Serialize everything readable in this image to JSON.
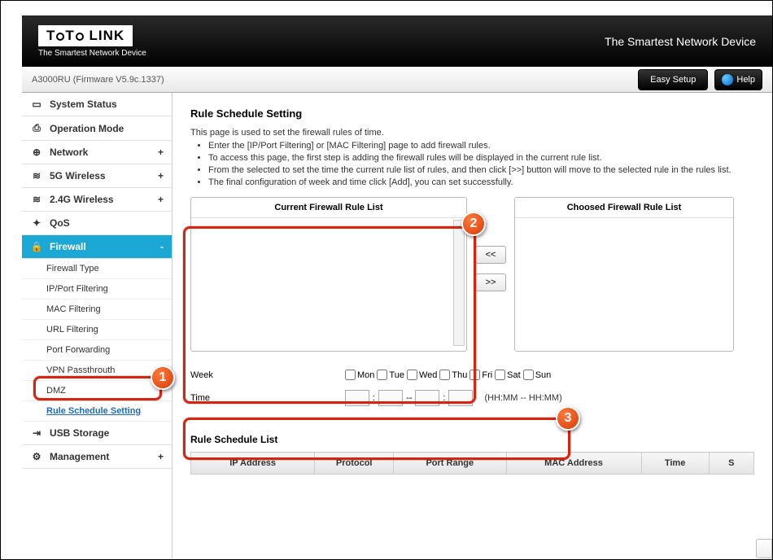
{
  "brand": {
    "name": "TOTO LINK",
    "tagline": "The Smartest Network Device"
  },
  "top_tagline": "The Smartest Network Device",
  "infobar": {
    "model": "A3000RU (Firmware V5.9c.1337)",
    "easy_setup": "Easy Setup",
    "help": "Help"
  },
  "nav": {
    "items": [
      {
        "label": "System Status",
        "icon": "▭"
      },
      {
        "label": "Operation Mode",
        "icon": "⎙"
      },
      {
        "label": "Network",
        "icon": "⊕",
        "exp": "+"
      },
      {
        "label": "5G Wireless",
        "icon": "≋",
        "exp": "+"
      },
      {
        "label": "2.4G Wireless",
        "icon": "≋",
        "exp": "+"
      },
      {
        "label": "QoS",
        "icon": "✦"
      },
      {
        "label": "Firewall",
        "icon": "🔒",
        "exp": "-",
        "active": true
      },
      {
        "label": "USB Storage",
        "icon": "⇥"
      },
      {
        "label": "Management",
        "icon": "⚙",
        "exp": "+"
      }
    ],
    "firewall_subs": [
      "Firewall Type",
      "IP/Port Filtering",
      "MAC Filtering",
      "URL Filtering",
      "Port Forwarding",
      "VPN Passthrouth",
      "DMZ",
      "Rule Schedule Setting"
    ]
  },
  "page": {
    "title": "Rule Schedule Setting",
    "intro": "This page is used to set the firewall rules of time.",
    "bullets": [
      "Enter the [IP/Port Filtering] or [MAC Filtering] page to add firewall rules.",
      "To access this page, the first step is adding the firewall rules will be displayed in the current rule list.",
      "From the selected to set the time the current rule list of rules, and then click [>>] button will move to the selected rule in the rules list.",
      "The final configuration of week and time click [Add], you can set successfully."
    ],
    "left_list_title": "Current Firewall Rule List",
    "right_list_title": "Choosed Firewall Rule List",
    "btn_left": "<<",
    "btn_right": ">>",
    "week_label": "Week",
    "days": [
      "Mon",
      "Tue",
      "Wed",
      "Thu",
      "Fri",
      "Sat",
      "Sun"
    ],
    "time_label": "Time",
    "time_dash": "--",
    "time_colon": ":",
    "time_hint": "(HH:MM -- HH:MM)",
    "list_title": "Rule Schedule List",
    "cols": [
      "IP Address",
      "Protocol",
      "Port Range",
      "MAC Address",
      "Time",
      "S"
    ]
  },
  "badges": {
    "b1": "1",
    "b2": "2",
    "b3": "3"
  }
}
